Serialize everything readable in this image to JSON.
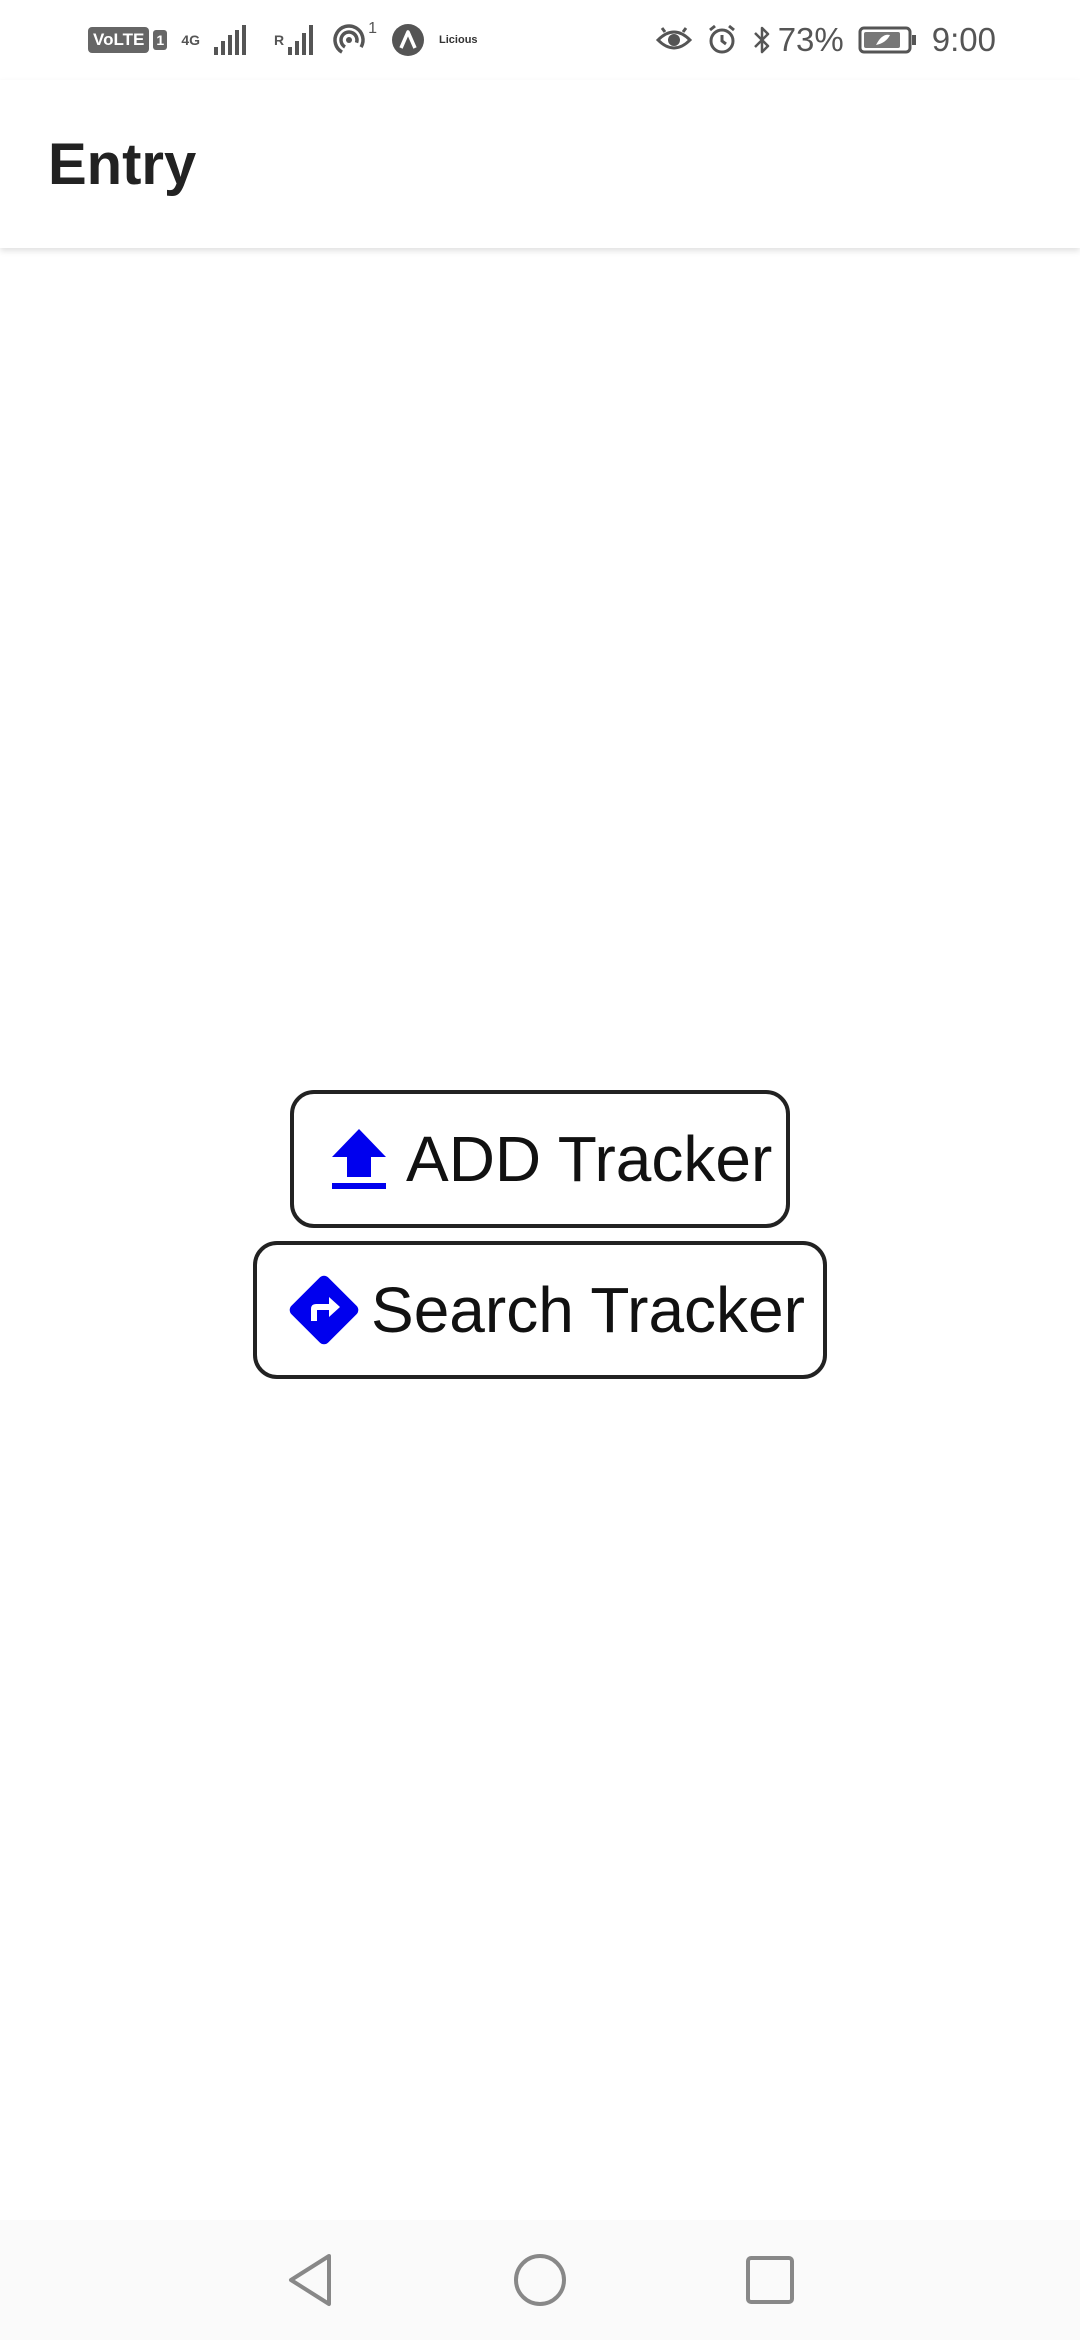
{
  "status_bar": {
    "volte": "VoLTE",
    "sim": "1",
    "network_type": "4G",
    "network_r": "R",
    "hotspot_count": "1",
    "brand": "Licious",
    "battery_percent": "73%",
    "time": "9:00",
    "icons": [
      "signal-icon",
      "hotspot-icon",
      "app-a-icon",
      "eye-icon",
      "alarm-icon",
      "bluetooth-icon",
      "battery-icon"
    ]
  },
  "app_bar": {
    "title": "Entry"
  },
  "buttons": {
    "add": {
      "label": "ADD Tracker",
      "icon": "upload-icon"
    },
    "search": {
      "label": "Search Tracker",
      "icon": "directions-icon"
    }
  },
  "nav_bar": {
    "icons": [
      "back-icon",
      "home-icon",
      "recents-icon"
    ]
  },
  "colors": {
    "icon_blue": "#0000ee",
    "border": "#222222",
    "text": "#111111"
  }
}
